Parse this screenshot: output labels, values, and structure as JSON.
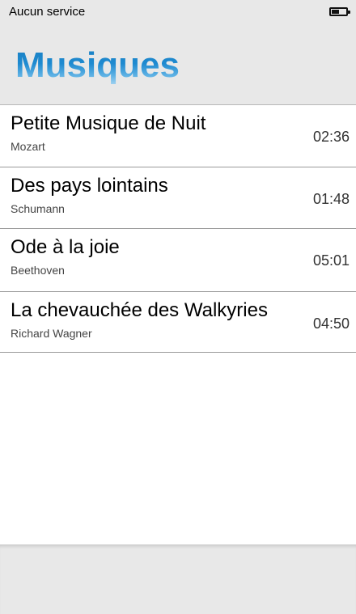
{
  "status_bar": {
    "carrier": "Aucun service",
    "battery_icon": "battery-icon",
    "battery_level": 0.55
  },
  "header": {
    "title": "Musiques",
    "title_colors": [
      "#1a7fc2",
      "#a9d6f2"
    ]
  },
  "tracks": [
    {
      "title": "Petite Musique de Nuit",
      "artist": "Mozart",
      "duration": "02:36"
    },
    {
      "title": "Des pays lointains",
      "artist": "Schumann",
      "duration": "01:48"
    },
    {
      "title": "Ode à la joie",
      "artist": "Beethoven",
      "duration": "05:01"
    },
    {
      "title": "La chevauchée des Walkyries",
      "artist": "Richard Wagner",
      "duration": "04:50"
    }
  ],
  "colors": {
    "bar_background": "#e8e8e8",
    "divider": "#9a9a9a"
  }
}
